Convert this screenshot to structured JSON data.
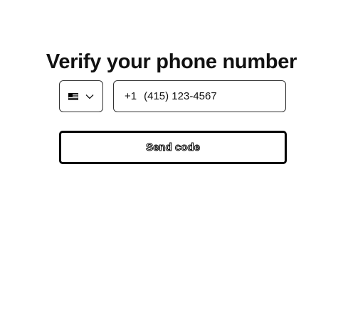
{
  "header": {
    "title": "Verify your phone number"
  },
  "phone": {
    "country_icon": "us-flag-icon",
    "dial_code": "+1",
    "number": "(415) 123-4567"
  },
  "actions": {
    "send_label": "Send code"
  },
  "colors": {
    "text": "#111111",
    "border": "#333333",
    "button_border": "#000000",
    "background": "#ffffff"
  }
}
